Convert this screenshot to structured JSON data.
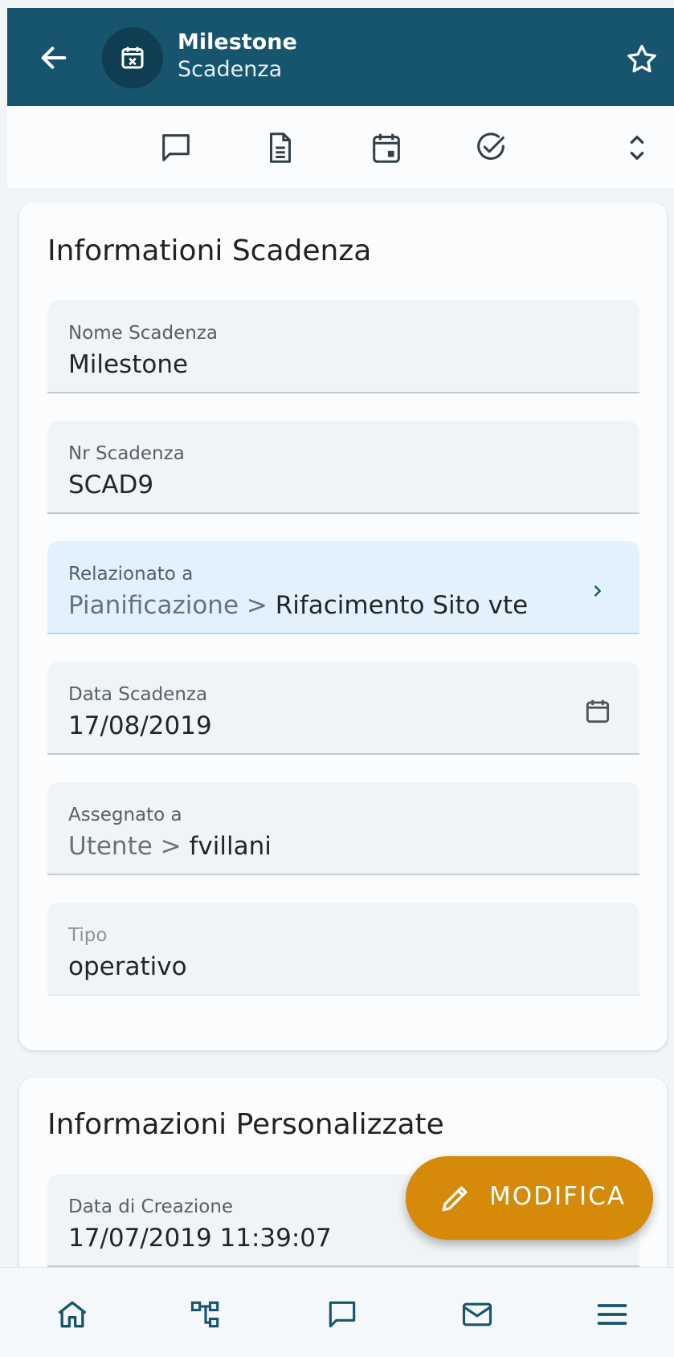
{
  "header": {
    "title": "Milestone",
    "subtitle": "Scadenza",
    "back_icon": "arrow-left-icon",
    "avatar_icon": "calendar-x-icon",
    "star_icon": "star-outline-icon",
    "background_color": "#17546e"
  },
  "toolbar": {
    "items": [
      {
        "icon": "comment-icon"
      },
      {
        "icon": "document-icon"
      },
      {
        "icon": "calendar-event-icon"
      },
      {
        "icon": "check-circle-icon"
      },
      {
        "icon": "expand-collapse-icon"
      }
    ]
  },
  "card_info": {
    "title": "Informationi Scadenza",
    "fields": [
      {
        "label": "Nome Scadenza",
        "value": "Milestone"
      },
      {
        "label": "Nr Scadenza",
        "value": "SCAD9"
      },
      {
        "label": "Relazionato a",
        "prefix": "Pianificazione > ",
        "value": "Rifacimento Sito vte"
      },
      {
        "label": "Data Scadenza",
        "value": "17/08/2019"
      },
      {
        "label": "Assegnato a",
        "prefix": "Utente > ",
        "value": "fvillani"
      },
      {
        "label": "Tipo",
        "value": "operativo"
      }
    ]
  },
  "card_custom": {
    "title": "Informazioni Personalizzate",
    "fields": [
      {
        "label": "Data di Creazione",
        "value": "17/07/2019 11:39:07"
      }
    ]
  },
  "fab": {
    "label": "MODIFICA",
    "icon": "pencil-icon",
    "color": "#d58a0a"
  },
  "bottom_nav": [
    {
      "icon": "home-icon"
    },
    {
      "icon": "hierarchy-icon"
    },
    {
      "icon": "comment-icon"
    },
    {
      "icon": "mail-icon"
    },
    {
      "icon": "menu-icon"
    }
  ]
}
